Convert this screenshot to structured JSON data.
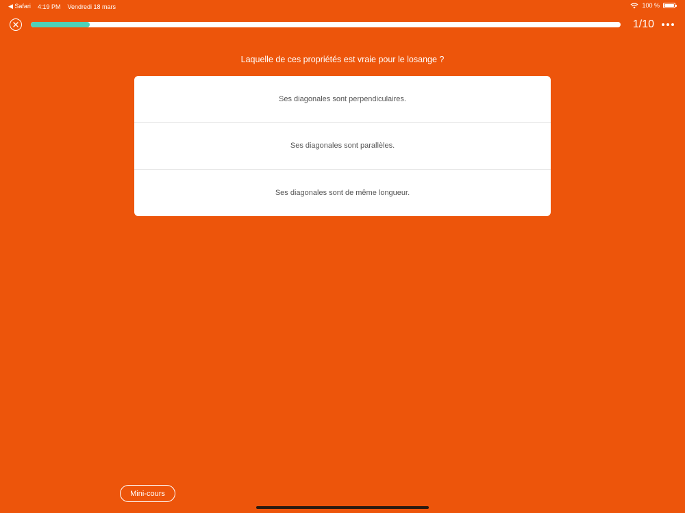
{
  "status_bar": {
    "back_app": "◀ Safari",
    "time": "4:19 PM",
    "date": "Vendredi 18 mars",
    "battery": "100 %"
  },
  "quiz": {
    "progress_fraction": 0.1,
    "progress_color": "#4FD1B7",
    "counter": "1/10",
    "question": "Laquelle de ces propriétés est vraie pour le losange ?",
    "answers": [
      "Ses diagonales sont perpendiculaires.",
      "Ses diagonales sont parallèles.",
      "Ses diagonales sont de même longueur."
    ]
  },
  "footer": {
    "mini_cours_label": "Mini-cours"
  },
  "theme": {
    "background": "#ED550B"
  },
  "icons": {
    "close": "close-icon",
    "more": "more-icon",
    "wifi": "wifi-icon",
    "battery": "battery-icon"
  }
}
